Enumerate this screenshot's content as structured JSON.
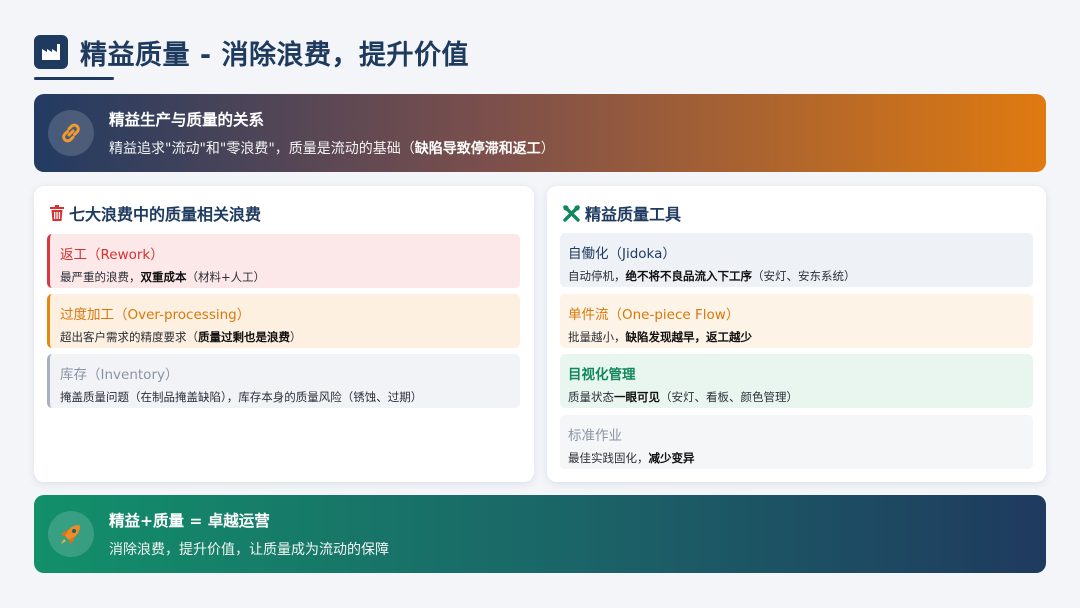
{
  "header": {
    "title": "精益质量 - 消除浪费，提升价值"
  },
  "top_banner": {
    "title": "精益生产与质量的关系",
    "desc_plain": "精益追求\"流动\"和\"零浪费\"，质量是流动的基础（",
    "desc_bold": "缺陷导致停滞和返工",
    "desc_end": "）"
  },
  "left_panel": {
    "heading": "七大浪费中的质量相关浪费",
    "items": [
      {
        "title": "返工（Rework）",
        "desc_plain": "最严重的浪费，",
        "desc_bold": "双重成本",
        "desc_end": "（材料+人工）"
      },
      {
        "title": "过度加工（Over-processing）",
        "desc_plain": "超出客户需求的精度要求（",
        "desc_bold": "质量过剩也是浪费",
        "desc_end": "）"
      },
      {
        "title": "库存（Inventory）",
        "desc_plain": "掩盖质量问题（在制品掩盖缺陷），库存本身的质量风险（锈蚀、过期）",
        "desc_bold": "",
        "desc_end": ""
      }
    ]
  },
  "right_panel": {
    "heading": "精益质量工具",
    "items": [
      {
        "title": "自働化（Jidoka）",
        "desc_plain": "自动停机，",
        "desc_bold": "绝不将不良品流入下工序",
        "desc_end": "（安灯、安东系统）"
      },
      {
        "title": "单件流（One-piece Flow）",
        "desc_plain": "批量越小，",
        "desc_bold": "缺陷发现越早，返工越少",
        "desc_end": ""
      },
      {
        "title": "目视化管理",
        "desc_plain": "质量状态",
        "desc_bold": "一眼可见",
        "desc_end": "（安灯、看板、颜色管理）"
      },
      {
        "title": "标准作业",
        "desc_plain": "最佳实践固化，",
        "desc_bold": "减少变异",
        "desc_end": ""
      }
    ]
  },
  "bottom_banner": {
    "title": "精益+质量 = 卓越运营",
    "desc": "消除浪费，提升价值，让质量成为流动的保障"
  },
  "colors": {
    "primary": "#1e3a5f",
    "orange": "#df7a10",
    "green": "#12906a",
    "red": "#d63031",
    "gray": "#8a94a6"
  },
  "icons": {
    "header": "factory-icon",
    "top_banner": "link-icon",
    "left_panel": "trash-icon",
    "right_panel": "tools-icon",
    "bottom_banner": "rocket-icon"
  }
}
